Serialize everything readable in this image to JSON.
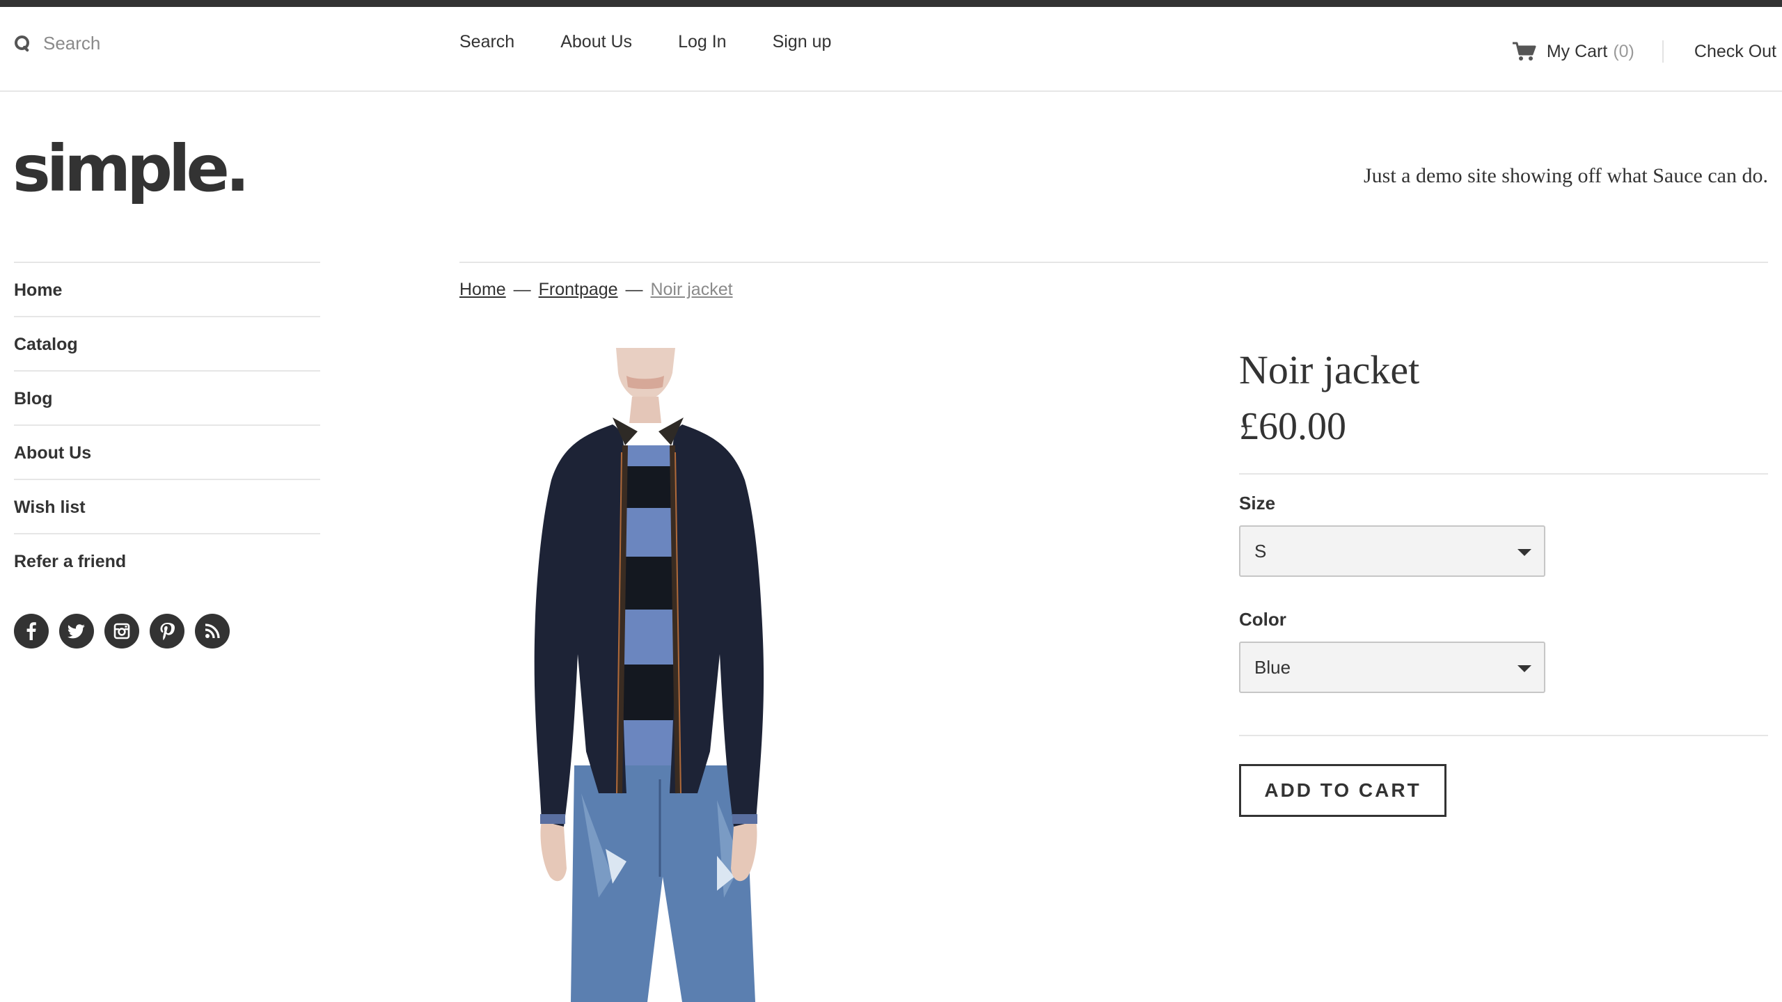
{
  "header": {
    "search_placeholder": "Search",
    "nav": [
      "Search",
      "About Us",
      "Log In",
      "Sign up"
    ],
    "cart_label": "My Cart",
    "cart_count": "(0)",
    "checkout_label": "Check Out"
  },
  "brand": {
    "logo_text": "simple.",
    "tagline": "Just a demo site showing off what Sauce can do."
  },
  "sidebar": {
    "items": [
      {
        "label": "Home"
      },
      {
        "label": "Catalog"
      },
      {
        "label": "Blog"
      },
      {
        "label": "About Us"
      },
      {
        "label": "Wish list"
      },
      {
        "label": "Refer a friend"
      }
    ],
    "social_icons": [
      "facebook-icon",
      "twitter-icon",
      "instagram-icon",
      "pinterest-icon",
      "rss-icon"
    ]
  },
  "breadcrumb": {
    "home": "Home",
    "section": "Frontpage",
    "current": "Noir jacket",
    "separator": "—"
  },
  "product": {
    "title": "Noir jacket",
    "price": "£60.00",
    "size_label": "Size",
    "size_value": "S",
    "color_label": "Color",
    "color_value": "Blue",
    "add_to_cart_label": "ADD TO CART"
  },
  "colors": {
    "accent": "#333333",
    "muted": "#8a8a8a",
    "rule": "#e6e6e6",
    "jacket": "#1d2336",
    "denim": "#5b7fb0"
  }
}
